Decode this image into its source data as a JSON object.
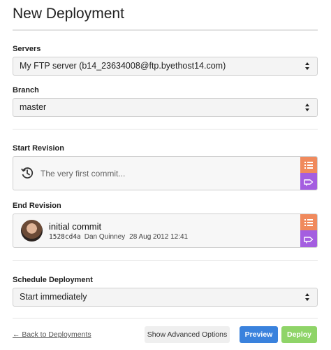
{
  "page": {
    "title": "New Deployment"
  },
  "servers": {
    "label": "Servers",
    "selected": "My FTP server (b14_23634008@ftp.byethost14.com)"
  },
  "branch": {
    "label": "Branch",
    "selected": "master"
  },
  "start_revision": {
    "label": "Start Revision",
    "placeholder": "The very first commit...",
    "icons": [
      "history-icon",
      "list-icon",
      "tag-icon"
    ]
  },
  "end_revision": {
    "label": "End Revision",
    "commit_title": "initial commit",
    "hash": "1528cd4a",
    "author": "Dan Quinney",
    "date": "28 Aug 2012 12:41",
    "icons": [
      "avatar",
      "list-icon",
      "tag-icon"
    ]
  },
  "schedule": {
    "label": "Schedule Deployment",
    "selected": "Start immediately"
  },
  "footer": {
    "back_link": "← Back to Deployments",
    "advanced_button": "Show Advanced Options",
    "preview_button": "Preview",
    "deploy_button": "Deploy"
  },
  "colors": {
    "list_button": "#f08a5d",
    "tag_button": "#a45ee0",
    "preview": "#3a82dd",
    "deploy": "#8fd468"
  }
}
